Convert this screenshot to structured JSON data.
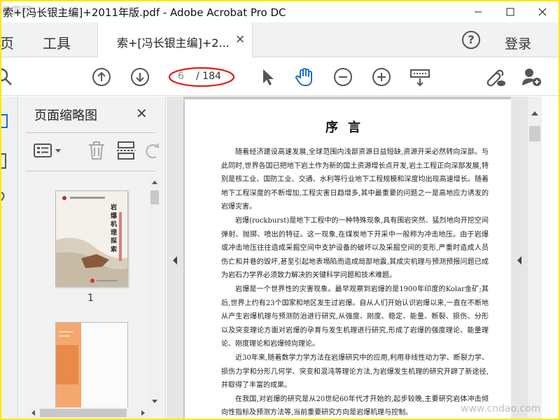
{
  "window": {
    "title": "索+[冯长银主编]+2011年版.pdf - Adobe Acrobat Pro DC",
    "watermark_top_left": "迅雷网",
    "watermark_bottom_right": "www.cndao.com"
  },
  "tabs": {
    "home_label": "主页",
    "tools_label": "工具",
    "document_tab_label": "索+[冯长银主编]+2...",
    "help_label": "?",
    "login_label": "登录"
  },
  "toolbar": {
    "current_page": "6",
    "total_pages": "/ 184"
  },
  "thumbnails": {
    "panel_title": "页面缩略图",
    "close_label": "✕",
    "page1_label": "1",
    "cover_title_chars": [
      "岩",
      "爆",
      "机",
      "理",
      "探",
      "索"
    ]
  },
  "document": {
    "heading": "序言",
    "paragraphs": [
      "随着经济建设高速发展,全球范围内浅部资源日益短缺,资源开采必然转向深部。与此同时,世界各国已把地下岩土作为新的国土资源增长点开发,岩土工程正向深部发展,特别是核工业、国防工业、交通、水利等行业地下工程规模和深度均出现高速增长。随着地下工程深度的不断增加,工程灾害日趋增多,其中最重要的问题之一是高地应力诱发的岩爆灾害。",
      "岩爆(rockburst)是地下工程中的一种特殊现象,具有围岩突然、猛烈地向开挖空间弹射、抛掷、喷出的特征。这一现象,在煤炭地下开采中一般称为冲击地压。由于岩爆或冲击地压往往造成采掘空间中支护设备的破坏以及采掘空间的变形,严重时造成人员伤亡和井巷的毁坏,甚至引起地表塌陷而造成局部地震,其成灾机理与预测预报问题已成为岩石力学界必须致力解决的关键科学问题和技术难题。",
      "岩爆是一个世界性的灾害现象。最早观察到岩爆的是1900年印度的Kolar金矿;其后,世界上约有23个国家和地区发生过岩爆。自从人们开始认识岩爆以来,一直在不断地从产生岩爆机理与预测防治进行研究,从强度、刚度、稳定、能量、断裂、损伤、分形以及突变理论方面对岩爆的孕育与发生机理进行研究,形成了岩爆的强度理论、能量理论、刚度理论和岩爆倾向理论。",
      "近30年来,随着数学力学方法在岩爆研究中的应用,利用非线性动力学、断裂力学、损伤力学和分形几何学、突变和混沌等理论方法,为岩爆发生机理的研究开辟了新途径,并取得了丰富的成果。",
      "在我国,对岩爆的研究是从20世纪60年代才开始的,起步较晚,主要研究岩体冲击倾向性指标及预测方法等,当前重要研究方向是岩爆机理与控制。"
    ]
  }
}
